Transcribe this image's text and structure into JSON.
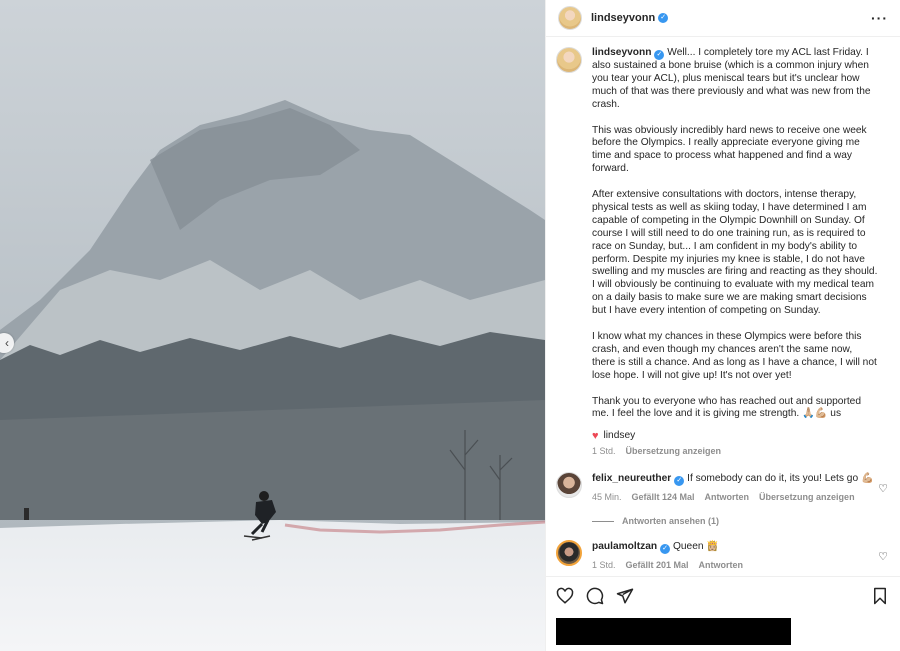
{
  "post": {
    "author": "lindseyvonn",
    "more_icon": "more-horizontal-icon",
    "caption_paragraphs": [
      "Well... I completely tore my ACL last Friday. I also sustained a bone bruise (which is a common injury when you tear your ACL), plus meniscal tears but it's unclear how much of that was there previously and what was new from the crash.",
      "This was obviously incredibly hard news to receive one week before the Olympics. I really appreciate everyone giving me time and space to process what happened and find a way forward.",
      "After extensive consultations with doctors, intense therapy, physical tests as well as skiing today, I have determined I am capable of competing in the Olympic Downhill on Sunday. Of course I will still need to do one training run, as is required to race on Sunday, but... I am confident in my body's ability to perform. Despite my injuries my knee is stable, I do not have swelling and my muscles are firing and reacting as they should. I will obviously be continuing to evaluate with my medical team on a daily basis to make sure we are making smart decisions but I have every intention of competing on Sunday.",
      "I know what my chances in these Olympics were before this crash, and even though my chances aren't the same now, there is still a chance. And as long as I have a chance, I will not lose hope. I will not give up! It's not over yet!",
      "Thank you to everyone who has reached out and supported me. I feel the love and it is giving me strength. 🙏🏼💪🏼 us"
    ],
    "signature": "lindsey",
    "time": "1 Std.",
    "translate": "Übersetzung anzeigen"
  },
  "comments": [
    {
      "user": "felix_neureuther",
      "text": "If somebody can do it, its you! Lets go 💪🏼",
      "time": "45 Min.",
      "likes": "Gefällt 124 Mal",
      "reply": "Antworten",
      "translate": "Übersetzung anzeigen",
      "view_replies": "Antworten ansehen (1)"
    },
    {
      "user": "paulamoltzan",
      "text": "Queen 👸🏼",
      "time": "1 Std.",
      "likes": "Gefällt 201 Mal",
      "reply": "Antworten"
    }
  ],
  "icons": {
    "like": "heart-icon",
    "comment": "comment-icon",
    "share": "share-icon",
    "save": "bookmark-icon",
    "carousel_prev": "chevron-left-icon"
  },
  "colors": {
    "verified": "#3897f0",
    "like_red": "#ed4956"
  }
}
